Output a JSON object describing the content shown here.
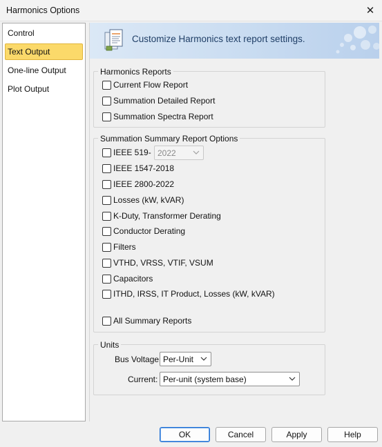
{
  "window": {
    "title": "Harmonics Options"
  },
  "nav": {
    "items": [
      {
        "label": "Control"
      },
      {
        "label": "Text Output"
      },
      {
        "label": "One-line Output"
      },
      {
        "label": "Plot Output"
      }
    ],
    "selected": "Text Output"
  },
  "header": {
    "title": "Customize Harmonics text report settings."
  },
  "harmonics_reports": {
    "legend": "Harmonics Reports",
    "options": [
      {
        "label": "Current Flow Report",
        "checked": false
      },
      {
        "label": "Summation Detailed Report",
        "checked": false
      },
      {
        "label": "Summation Spectra Report",
        "checked": false
      }
    ]
  },
  "summary_options": {
    "legend": "Summation Summary Report Options",
    "ieee519": {
      "label": "IEEE 519-",
      "checked": false,
      "year_value": "2022"
    },
    "options": [
      {
        "label": "IEEE 1547-2018",
        "checked": false
      },
      {
        "label": "IEEE 2800-2022",
        "checked": false
      },
      {
        "label": "Losses (kW, kVAR)",
        "checked": false
      },
      {
        "label": "K-Duty, Transformer Derating",
        "checked": false
      },
      {
        "label": "Conductor Derating",
        "checked": false
      },
      {
        "label": "Filters",
        "checked": false
      },
      {
        "label": "VTHD, VRSS, VTIF, VSUM",
        "checked": false
      },
      {
        "label": "Capacitors",
        "checked": false
      },
      {
        "label": "ITHD, IRSS, IT Product, Losses (kW, kVAR)",
        "checked": false
      }
    ],
    "all": {
      "label": "All Summary Reports",
      "checked": false
    }
  },
  "units": {
    "legend": "Units",
    "bus_voltage": {
      "label": "Bus Voltage:",
      "value": "Per-Unit"
    },
    "current": {
      "label": "Current:",
      "value": "Per-unit (system base)"
    }
  },
  "buttons": {
    "ok": "OK",
    "cancel": "Cancel",
    "apply": "Apply",
    "help": "Help"
  },
  "icons": {
    "close": "close-icon",
    "header": "report-settings-icon",
    "dropdown": "chevron-down-icon"
  },
  "colors": {
    "selected_nav": "#fbd96a",
    "header_gradient_start": "#dbe8f6",
    "header_gradient_end": "#b9d0ec",
    "header_text": "#1f3e66",
    "default_button_border": "#1f6fd4"
  }
}
